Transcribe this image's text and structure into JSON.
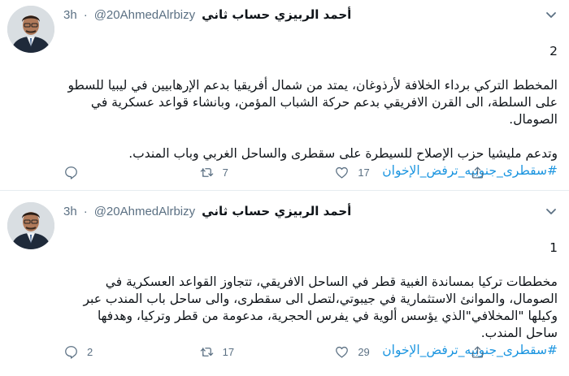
{
  "tweets": [
    {
      "author_name": "أحمد الربيزي حساب ثاني",
      "handle": "@20AhmedAlrbizy",
      "separator": "·",
      "time": "3h",
      "number": "2",
      "text": "المخطط التركي برداء الخلافة لأرذوغان، يمتد من شمال أفريقيا بدعم الإرهابيين في ليبيا للسطو على السلطة، الى القرن الافريقي بدعم حركة الشباب المؤمن، وبانشاء قواعد عسكرية في الصومال.\n\nوتدعم مليشيا حزب الإصلاح للسيطرة على سقطرى والساحل الغربي وباب المندب.",
      "hashtag": "#سقطری_جنوبیه_ترفض_الإخوان",
      "replies": "",
      "retweets": "7",
      "likes": "17"
    },
    {
      "author_name": "أحمد الربيزي حساب ثاني",
      "handle": "@20AhmedAlrbizy",
      "separator": "·",
      "time": "3h",
      "number": "1",
      "text": "مخططات تركيا بمساندة الغبية قطر في الساحل الافريقي، تتجاوز القواعد العسكرية في الصومال، والموانئ الاستثمارية في جيبوتي،لتصل الى سقطرى، والى ساحل باب المندب عبر وكيلها \"المخلافي\"الذي يؤسس ألوية في يفرس الحجرية، مدعومة من قطر وتركيا، وهدفها ساحل المندب.",
      "hashtag": "#سقطری_جنوبیه_ترفض_الإخوان",
      "replies": "2",
      "retweets": "17",
      "likes": "29"
    }
  ],
  "icons": {
    "reply": "reply-icon",
    "retweet": "retweet-icon",
    "like": "heart-icon",
    "share": "share-icon",
    "caret": "chevron-down-icon"
  },
  "colors": {
    "hashtag": "#1b95e0",
    "muted": "#5b7083",
    "divider": "#e6ecf0"
  }
}
